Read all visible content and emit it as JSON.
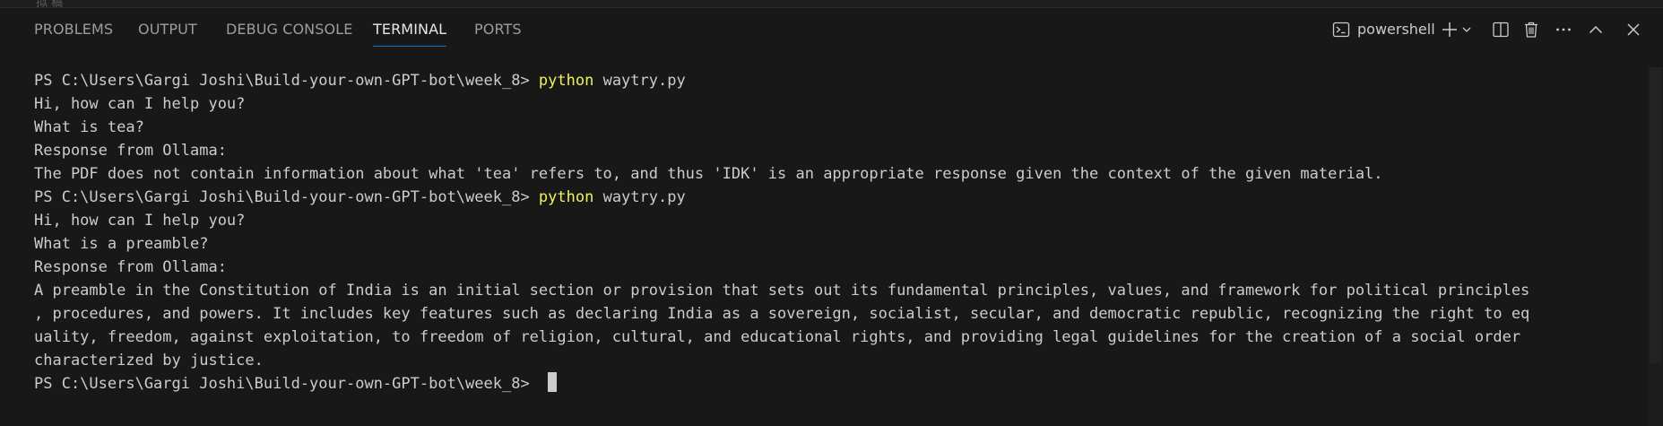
{
  "top_strip": {
    "fragment": "拟  稿"
  },
  "tabs": [
    {
      "label": "PROBLEMS",
      "active": false
    },
    {
      "label": "OUTPUT",
      "active": false
    },
    {
      "label": "DEBUG CONSOLE",
      "active": false
    },
    {
      "label": "TERMINAL",
      "active": true
    },
    {
      "label": "PORTS",
      "active": false
    }
  ],
  "toolbar": {
    "shell_icon": "terminal-powershell-icon",
    "shell_name": "powershell",
    "icons": [
      "plus-icon",
      "chevron-down-icon",
      "split-terminal-icon",
      "trash-icon",
      "more-actions-icon",
      "maximize-panel-icon",
      "close-icon"
    ]
  },
  "terminal": {
    "prompt": "PS C:\\Users\\Gargi Joshi\\Build-your-own-GPT-bot\\week_8> ",
    "lines": [
      {
        "prompt": "PS C:\\Users\\Gargi Joshi\\Build-your-own-GPT-bot\\week_8> ",
        "cmd": "python",
        "args": " waytry.py"
      },
      {
        "text": "Hi, how can I help you?"
      },
      {
        "text": "What is tea?"
      },
      {
        "text": "Response from Ollama:"
      },
      {
        "text": "The PDF does not contain information about what 'tea' refers to, and thus 'IDK' is an appropriate response given the context of the given material."
      },
      {
        "prompt": "PS C:\\Users\\Gargi Joshi\\Build-your-own-GPT-bot\\week_8> ",
        "cmd": "python",
        "args": " waytry.py"
      },
      {
        "text": "Hi, how can I help you?"
      },
      {
        "text": "What is a preamble?"
      },
      {
        "text": "Response from Ollama:"
      },
      {
        "text": "A preamble in the Constitution of India is an initial section or provision that sets out its fundamental principles, values, and framework for political principles"
      },
      {
        "text": ", procedures, and powers. It includes key features such as declaring India as a sovereign, socialist, secular, and democratic republic, recognizing the right to eq"
      },
      {
        "text": "uality, freedom, against exploitation, to freedom of religion, cultural, and educational rights, and providing legal guidelines for the creation of a social order"
      },
      {
        "text": "characterized by justice."
      }
    ],
    "current_prompt": "PS C:\\Users\\Gargi Joshi\\Build-your-own-GPT-bot\\week_8> "
  },
  "colors": {
    "background": "#181818",
    "text": "#cccccc",
    "command": "#f1f15a",
    "active_tab_underline": "#0078d4"
  }
}
